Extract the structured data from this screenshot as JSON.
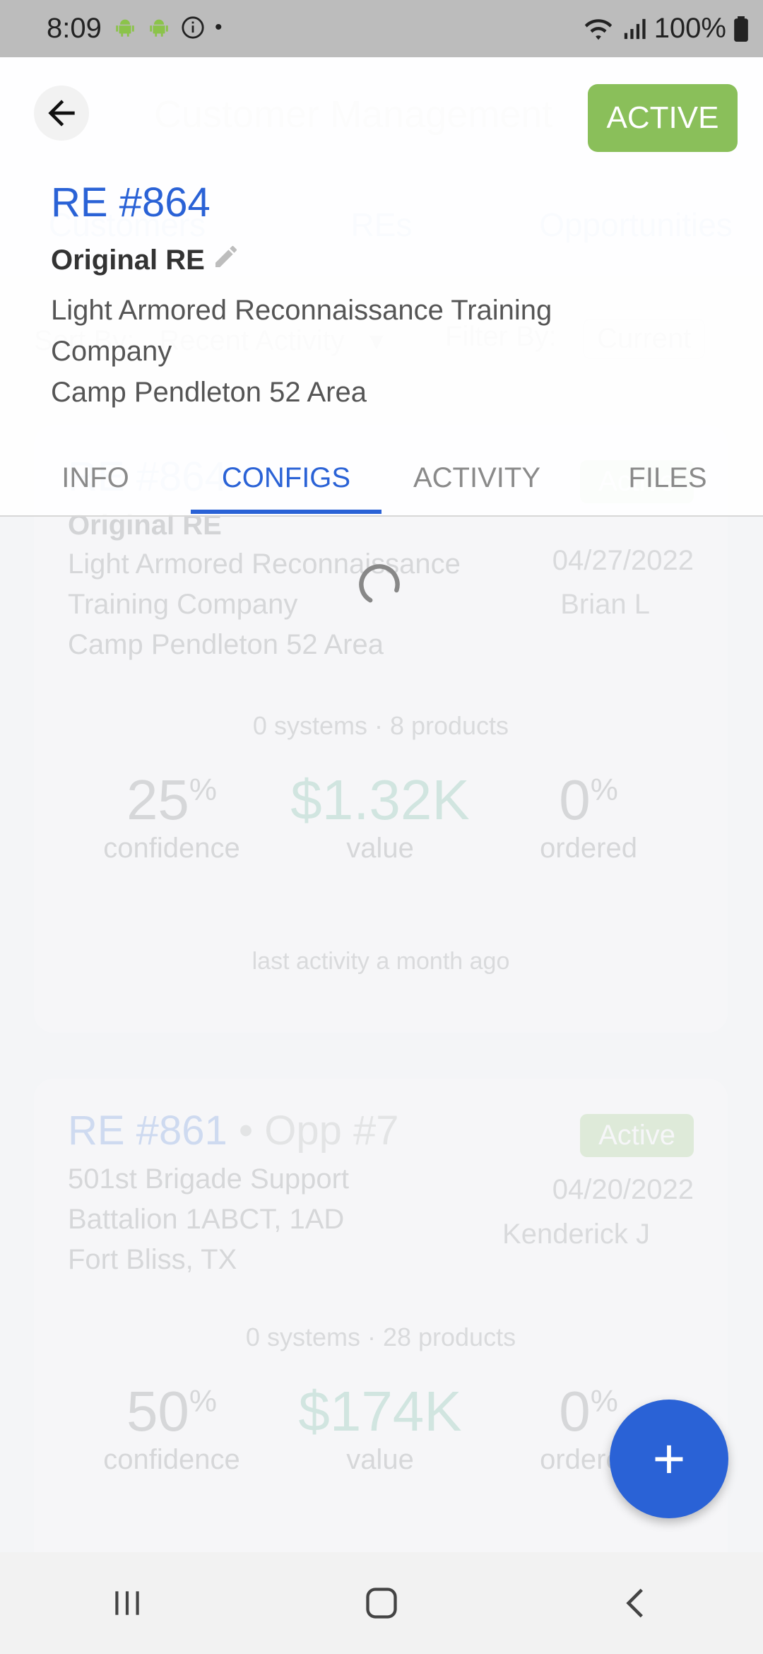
{
  "status_bar": {
    "time": "8:09",
    "battery": "100%",
    "dot": "•"
  },
  "background": {
    "title": "Customer Management",
    "tabs": [
      "Customers",
      "REs",
      "Opportunities"
    ],
    "sort_label": "Sort By:",
    "sort_value": "Recent Activity",
    "filter_label": "Filter By:",
    "filter_value": "Current",
    "cards": [
      {
        "title": "RE #864",
        "opp": "",
        "status": "Active",
        "subtitle": "Original RE",
        "lines": [
          "Light Armored Reconnaissance",
          "Training Company",
          "Camp Pendleton 52 Area"
        ],
        "date": "04/27/2022",
        "user": "Brian L",
        "summary": "0 systems · 8 products",
        "confidence": "25",
        "confidence_unit": "%",
        "confidence_label": "confidence",
        "value": "$1.32K",
        "value_label": "value",
        "ordered": "0",
        "ordered_unit": "%",
        "ordered_label": "ordered",
        "last_activity": "last activity a month ago"
      },
      {
        "title": "RE #861",
        "opp": "• Opp #7",
        "status": "Active",
        "subtitle": "",
        "lines": [
          "501st Brigade Support",
          "Battalion 1ABCT, 1AD",
          "Fort Bliss, TX"
        ],
        "date": "04/20/2022",
        "user": "Kenderick J",
        "summary": "0 systems · 28 products",
        "confidence": "50",
        "confidence_unit": "%",
        "confidence_label": "confidence",
        "value": "$174K",
        "value_label": "value",
        "ordered": "0",
        "ordered_unit": "%",
        "ordered_label": "ordered",
        "last_activity": ""
      }
    ]
  },
  "detail": {
    "status": "ACTIVE",
    "title": "RE #864",
    "subtitle": "Original RE",
    "description_line1": "Light Armored Reconnaissance Training",
    "description_line2": "Company",
    "location": "Camp Pendleton 52 Area",
    "tabs": [
      "INFO",
      "CONFIGS",
      "ACTIVITY",
      "FILES"
    ],
    "active_tab": "CONFIGS"
  },
  "fab_label": "+",
  "colors": {
    "primary": "#2a62d6",
    "active_green": "#8abf5a",
    "value_green": "#3aa27b"
  }
}
